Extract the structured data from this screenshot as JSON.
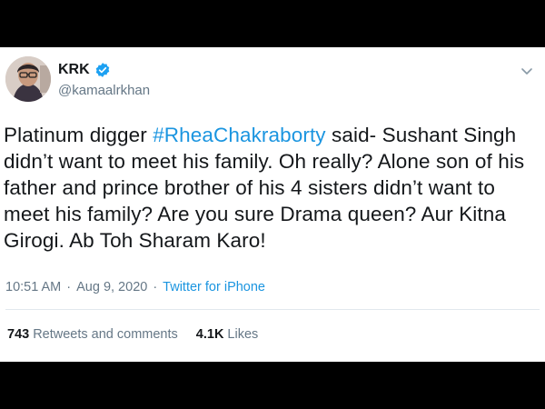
{
  "author": {
    "name": "KRK",
    "handle": "@kamaalrkhan",
    "verified": true
  },
  "tweet": {
    "text_before": "Platinum digger ",
    "hashtag": "#RheaChakraborty",
    "text_after": " said- Sushant Singh didn’t want to meet his family. Oh really? Alone son of his father and prince brother of his 4 sisters didn’t want to meet his family? Are you sure Drama queen? Aur Kitna Girogi. Ab Toh Sharam Karo!"
  },
  "meta": {
    "time": "10:51 AM",
    "separator": "·",
    "date": "Aug 9, 2020",
    "source": "Twitter for iPhone"
  },
  "stats": {
    "retweets_count": "743",
    "retweets_label": "Retweets and comments",
    "likes_count": "4.1K",
    "likes_label": "Likes"
  },
  "colors": {
    "link": "#1b95e0",
    "verified_badge": "#1da1f2",
    "secondary_text": "#657786"
  },
  "icons": [
    "verified-badge-icon",
    "chevron-down-icon"
  ]
}
